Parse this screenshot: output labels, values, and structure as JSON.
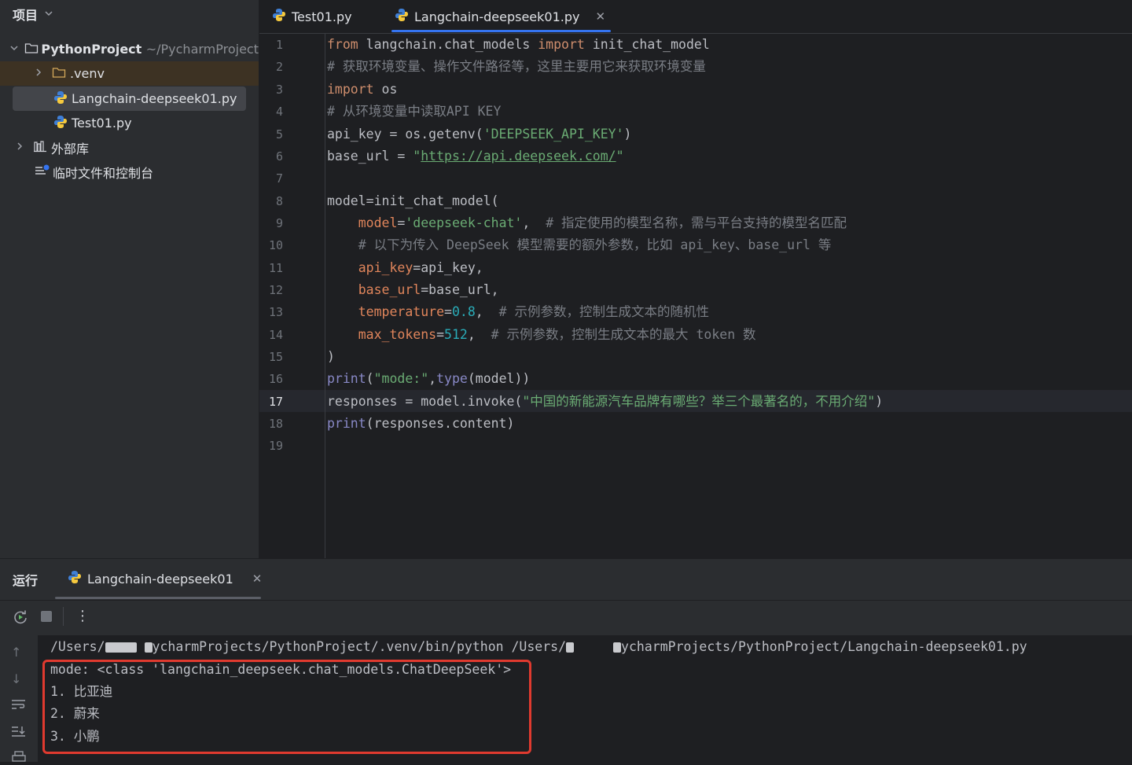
{
  "sidebar": {
    "header": "项目",
    "tree": [
      {
        "label": "PythonProject",
        "path_hint": "~/PycharmProject",
        "type": "folder",
        "expanded": true
      },
      {
        "label": ".venv",
        "type": "folder",
        "expanded": false
      },
      {
        "label": "Langchain-deepseek01.py",
        "type": "python-file",
        "selected": true
      },
      {
        "label": "Test01.py",
        "type": "python-file"
      },
      {
        "label": "外部库",
        "type": "library",
        "expanded": false
      },
      {
        "label": "临时文件和控制台",
        "type": "scratches"
      }
    ]
  },
  "editor": {
    "tabs": [
      {
        "label": "Test01.py",
        "active": false
      },
      {
        "label": "Langchain-deepseek01.py",
        "active": true
      }
    ],
    "current_line": 17,
    "line_numbers": [
      "1",
      "2",
      "3",
      "4",
      "5",
      "6",
      "7",
      "8",
      "9",
      "10",
      "11",
      "12",
      "13",
      "14",
      "15",
      "16",
      "17",
      "18",
      "19"
    ],
    "code": {
      "l1_from": "from",
      "l1_mod": " langchain.chat_models ",
      "l1_import": "import",
      "l1_name": " init_chat_model",
      "l2": "# 获取环境变量、操作文件路径等，这里主要用它来获取环境变量",
      "l3_import": "import",
      "l3_name": " os",
      "l4": "# 从环境变量中读取API KEY",
      "l5_a": "api_key = os.getenv(",
      "l5_str": "'DEEPSEEK_API_KEY'",
      "l5_b": ")",
      "l6_a": "base_url = ",
      "l6_q1": "\"",
      "l6_url": "https://api.deepseek.com/",
      "l6_q2": "\"",
      "l8": "model=init_chat_model(",
      "l9_prm": "model",
      "l9_eq": "=",
      "l9_str": "'deepseek-chat'",
      "l9_comma": ",  ",
      "l9_cm": "# 指定使用的模型名称，需与平台支持的模型名匹配",
      "l10_cm": "# 以下为传入 DeepSeek 模型需要的额外参数，比如 api_key、base_url 等",
      "l11_prm": "api_key",
      "l11_rest": "=api_key,",
      "l12_prm": "base_url",
      "l12_rest": "=base_url,",
      "l13_prm": "temperature",
      "l13_eq": "=",
      "l13_num": "0.8",
      "l13_comma": ",  ",
      "l13_cm": "# 示例参数，控制生成文本的随机性",
      "l14_prm": "max_tokens",
      "l14_eq": "=",
      "l14_num": "512",
      "l14_comma": ",  ",
      "l14_cm": "# 示例参数，控制生成文本的最大 token 数",
      "l15": ")",
      "l16_print": "print",
      "l16_a": "(",
      "l16_str": "\"mode:\"",
      "l16_b": ",",
      "l16_type": "type",
      "l16_c": "(model))",
      "l17_a": "responses = model.invoke(",
      "l17_str": "\"中国的新能源汽车品牌有哪些？举三个最著名的，不用介绍\"",
      "l17_b": ")",
      "l18_print": "print",
      "l18_rest": "(responses.content)"
    }
  },
  "run_panel": {
    "title": "运行",
    "tab_label": "Langchain-deepseek01",
    "output": {
      "cmd_a": "/Users/",
      "cmd_b": "ycharmProjects/PythonProject/.venv/bin/python /Users/",
      "cmd_c": "ycharmProjects/PythonProject/Langchain-deepseek01.py",
      "line_mode": "mode: <class 'langchain_deepseek.chat_models.ChatDeepSeek'>",
      "line_1": "1. 比亚迪",
      "line_2": "2. 蔚来",
      "line_3": "3. 小鹏"
    }
  },
  "colors": {
    "accent": "#3574f0",
    "highlight_box": "#e03a2f",
    "keyword": "#cf8e6d",
    "string": "#6aab73",
    "comment": "#7a7e85",
    "number": "#2aacb8",
    "param": "#e0855b"
  }
}
